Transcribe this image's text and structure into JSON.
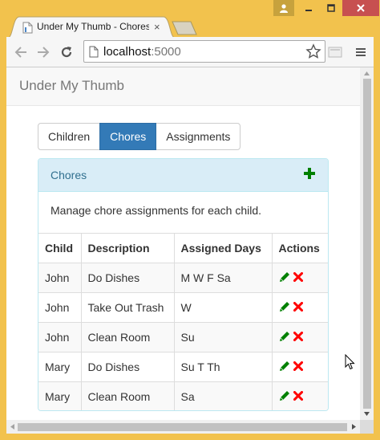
{
  "window": {
    "tab_title": "Under My Thumb - Chores",
    "tab_close": "×"
  },
  "toolbar": {
    "url_host": "localhost",
    "url_port": ":5000"
  },
  "app": {
    "brand": "Under My Thumb"
  },
  "nav_buttons": [
    {
      "label": "Children",
      "active": false
    },
    {
      "label": "Chores",
      "active": true
    },
    {
      "label": "Assignments",
      "active": false
    }
  ],
  "panel": {
    "title": "Chores",
    "description": "Manage chore assignments for each child.",
    "add_icon": "plus-icon",
    "accent": "#008000"
  },
  "table": {
    "headers": [
      "Child",
      "Description",
      "Assigned Days",
      "Actions"
    ],
    "rows": [
      {
        "child": "John",
        "description": "Do Dishes",
        "days": "M W F Sa"
      },
      {
        "child": "John",
        "description": "Take Out Trash",
        "days": "W"
      },
      {
        "child": "John",
        "description": "Clean Room",
        "days": "Su"
      },
      {
        "child": "Mary",
        "description": "Do Dishes",
        "days": "Su T Th"
      },
      {
        "child": "Mary",
        "description": "Clean Room",
        "days": "Sa"
      }
    ],
    "row_actions": [
      "pencil-icon",
      "x-icon"
    ],
    "edit_color": "#008000",
    "delete_color": "#ff0000"
  }
}
